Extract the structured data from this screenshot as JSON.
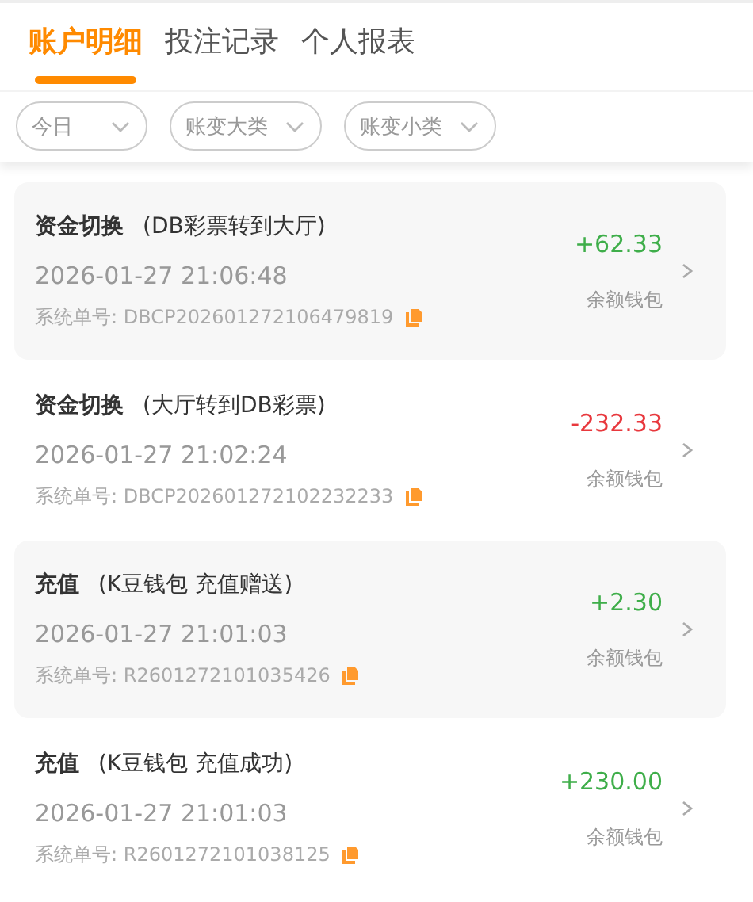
{
  "tabs": [
    {
      "label": "账户明细",
      "selected": true
    },
    {
      "label": "投注记录",
      "selected": false
    },
    {
      "label": "个人报表",
      "selected": false
    }
  ],
  "filters": [
    {
      "label": "今日"
    },
    {
      "label": "账变大类"
    },
    {
      "label": "账变小类"
    }
  ],
  "records": [
    {
      "type": "资金切换",
      "detail": "(DB彩票转到大厅)",
      "time": "2026-01-27 21:06:48",
      "order_label": "系统单号:",
      "order_no": "DBCP202601272106479819",
      "amount": "+62.33",
      "kind": "income",
      "wallet": "余额钱包"
    },
    {
      "type": "资金切换",
      "detail": "(大厅转到DB彩票)",
      "time": "2026-01-27 21:02:24",
      "order_label": "系统单号:",
      "order_no": "DBCP202601272102232233",
      "amount": "-232.33",
      "kind": "expense",
      "wallet": "余额钱包"
    },
    {
      "type": "充值",
      "detail": "(K豆钱包 充值赠送)",
      "time": "2026-01-27 21:01:03",
      "order_label": "系统单号:",
      "order_no": "R2601272101035426",
      "amount": "+2.30",
      "kind": "income",
      "wallet": "余额钱包"
    },
    {
      "type": "充值",
      "detail": "(K豆钱包 充值成功)",
      "time": "2026-01-27 21:01:03",
      "order_label": "系统单号:",
      "order_no": "R2601272101038125",
      "amount": "+230.00",
      "kind": "income",
      "wallet": "余额钱包"
    }
  ]
}
